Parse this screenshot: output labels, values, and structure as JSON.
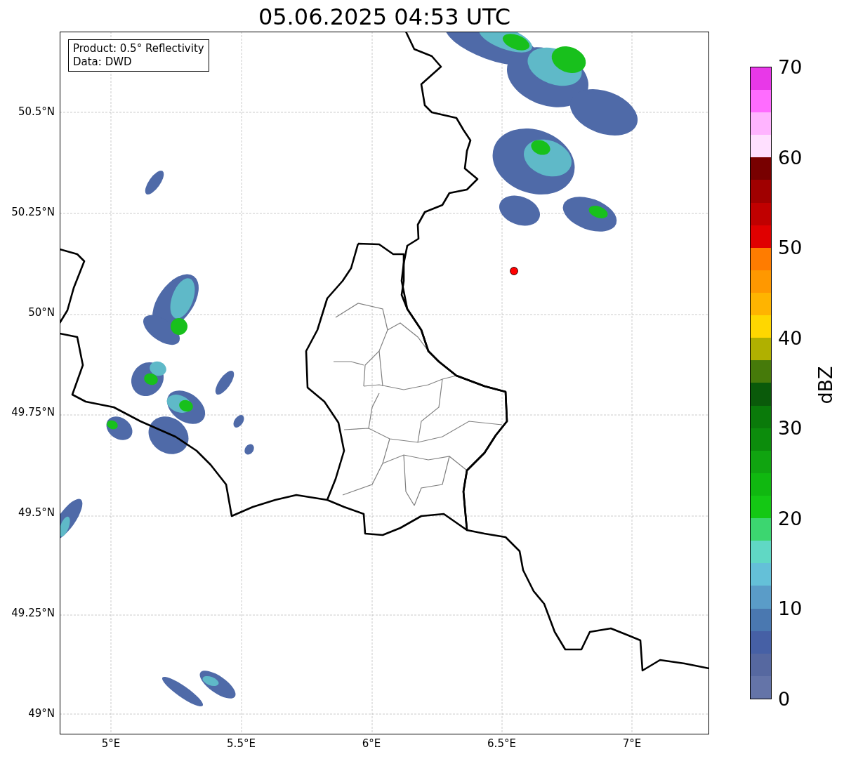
{
  "title": "05.06.2025 04:53 UTC",
  "legend": {
    "lines": [
      "Product: 0.5° Reflectivity",
      "Data: DWD"
    ]
  },
  "map": {
    "lat_labels": [
      "50.5°N",
      "50.25°N",
      "50°N",
      "49.75°N",
      "49.5°N",
      "49.25°N",
      "49°N"
    ],
    "lon_labels": [
      "5°E",
      "5.5°E",
      "6°E",
      "6.5°E",
      "7°E"
    ]
  },
  "colorbar": {
    "label": "dBZ",
    "ticks": [
      "70",
      "60",
      "50",
      "40",
      "30",
      "20",
      "10",
      "0"
    ],
    "segments": [
      {
        "color": "#6474a8"
      },
      {
        "color": "#5668a0"
      },
      {
        "color": "#4660a5"
      },
      {
        "color": "#4a78b0"
      },
      {
        "color": "#5a9cc8"
      },
      {
        "color": "#64c0d8"
      },
      {
        "color": "#60d8c4"
      },
      {
        "color": "#3cd670"
      },
      {
        "color": "#14c814"
      },
      {
        "color": "#10b810"
      },
      {
        "color": "#10a410"
      },
      {
        "color": "#0c8c0c"
      },
      {
        "color": "#0a7a0a"
      },
      {
        "color": "#0a5a0a"
      },
      {
        "color": "#467a0a"
      },
      {
        "color": "#b0b000"
      },
      {
        "color": "#ffd700"
      },
      {
        "color": "#ffb400"
      },
      {
        "color": "#ff9800"
      },
      {
        "color": "#ff7c00"
      },
      {
        "color": "#e00000"
      },
      {
        "color": "#c00000"
      },
      {
        "color": "#a00000"
      },
      {
        "color": "#780000"
      },
      {
        "color": "#ffe0ff"
      },
      {
        "color": "#ffb4ff"
      },
      {
        "color": "#ff6cff"
      },
      {
        "color": "#e838e8"
      }
    ]
  }
}
